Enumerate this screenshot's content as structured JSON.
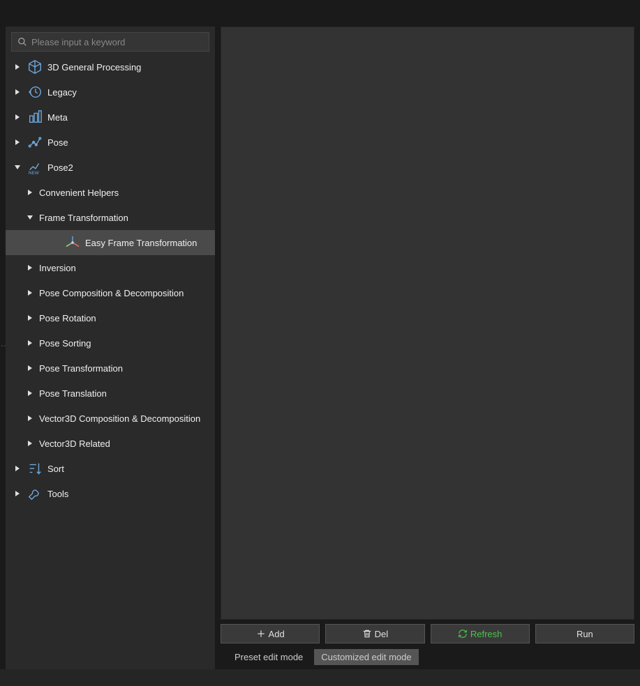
{
  "search": {
    "placeholder": "Please input a keyword"
  },
  "tree": [
    {
      "level": 0,
      "expanded": false,
      "icon": "cube3d",
      "label": "3D General Processing"
    },
    {
      "level": 0,
      "expanded": false,
      "icon": "clock-back",
      "label": "Legacy"
    },
    {
      "level": 0,
      "expanded": false,
      "icon": "meta",
      "label": "Meta"
    },
    {
      "level": 0,
      "expanded": false,
      "icon": "pose",
      "label": "Pose"
    },
    {
      "level": 0,
      "expanded": true,
      "icon": "pose-new",
      "label": "Pose2"
    },
    {
      "level": 1,
      "expanded": false,
      "icon": null,
      "label": "Convenient Helpers"
    },
    {
      "level": 1,
      "expanded": true,
      "icon": null,
      "label": "Frame Transformation"
    },
    {
      "level": 2,
      "expanded": null,
      "icon": "axes",
      "label": "Easy Frame Transformation",
      "selected": true
    },
    {
      "level": 1,
      "expanded": false,
      "icon": null,
      "label": "Inversion"
    },
    {
      "level": 1,
      "expanded": false,
      "icon": null,
      "label": "Pose Composition & Decomposition"
    },
    {
      "level": 1,
      "expanded": false,
      "icon": null,
      "label": "Pose Rotation"
    },
    {
      "level": 1,
      "expanded": false,
      "icon": null,
      "label": "Pose Sorting"
    },
    {
      "level": 1,
      "expanded": false,
      "icon": null,
      "label": "Pose Transformation"
    },
    {
      "level": 1,
      "expanded": false,
      "icon": null,
      "label": "Pose Translation"
    },
    {
      "level": 1,
      "expanded": false,
      "icon": null,
      "label": "Vector3D Composition & Decomposition"
    },
    {
      "level": 1,
      "expanded": false,
      "icon": null,
      "label": "Vector3D Related"
    },
    {
      "level": 0,
      "expanded": false,
      "icon": "sort",
      "label": "Sort"
    },
    {
      "level": 0,
      "expanded": false,
      "icon": "wrench",
      "label": "Tools"
    }
  ],
  "buttons": {
    "add": "Add",
    "del": "Del",
    "refresh": "Refresh",
    "run": "Run"
  },
  "modes": {
    "preset": "Preset edit mode",
    "custom": "Customized edit mode",
    "active": "custom"
  }
}
